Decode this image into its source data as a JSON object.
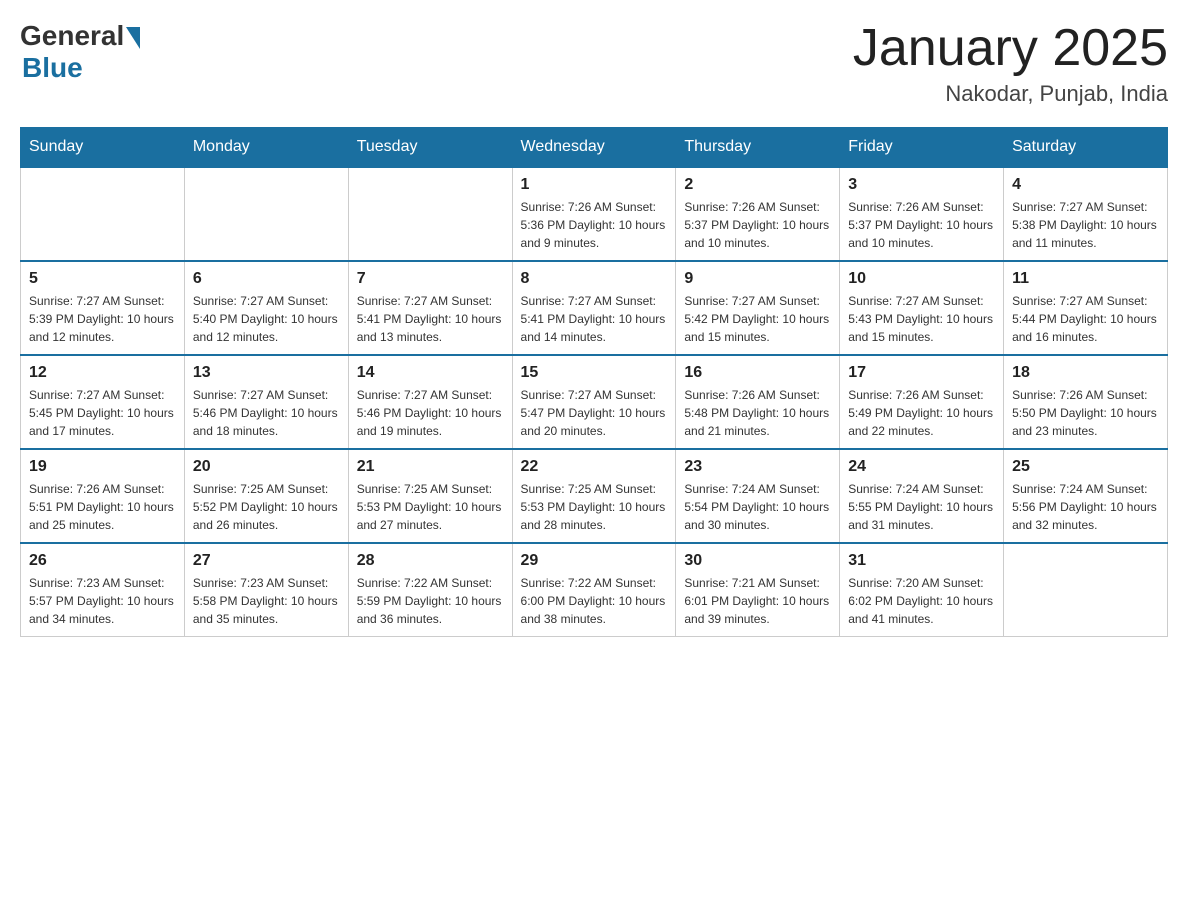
{
  "header": {
    "logo_general": "General",
    "logo_blue": "Blue",
    "month_year": "January 2025",
    "location": "Nakodar, Punjab, India"
  },
  "days_of_week": [
    "Sunday",
    "Monday",
    "Tuesday",
    "Wednesday",
    "Thursday",
    "Friday",
    "Saturday"
  ],
  "weeks": [
    [
      {
        "day": "",
        "info": ""
      },
      {
        "day": "",
        "info": ""
      },
      {
        "day": "",
        "info": ""
      },
      {
        "day": "1",
        "info": "Sunrise: 7:26 AM\nSunset: 5:36 PM\nDaylight: 10 hours and 9 minutes."
      },
      {
        "day": "2",
        "info": "Sunrise: 7:26 AM\nSunset: 5:37 PM\nDaylight: 10 hours and 10 minutes."
      },
      {
        "day": "3",
        "info": "Sunrise: 7:26 AM\nSunset: 5:37 PM\nDaylight: 10 hours and 10 minutes."
      },
      {
        "day": "4",
        "info": "Sunrise: 7:27 AM\nSunset: 5:38 PM\nDaylight: 10 hours and 11 minutes."
      }
    ],
    [
      {
        "day": "5",
        "info": "Sunrise: 7:27 AM\nSunset: 5:39 PM\nDaylight: 10 hours and 12 minutes."
      },
      {
        "day": "6",
        "info": "Sunrise: 7:27 AM\nSunset: 5:40 PM\nDaylight: 10 hours and 12 minutes."
      },
      {
        "day": "7",
        "info": "Sunrise: 7:27 AM\nSunset: 5:41 PM\nDaylight: 10 hours and 13 minutes."
      },
      {
        "day": "8",
        "info": "Sunrise: 7:27 AM\nSunset: 5:41 PM\nDaylight: 10 hours and 14 minutes."
      },
      {
        "day": "9",
        "info": "Sunrise: 7:27 AM\nSunset: 5:42 PM\nDaylight: 10 hours and 15 minutes."
      },
      {
        "day": "10",
        "info": "Sunrise: 7:27 AM\nSunset: 5:43 PM\nDaylight: 10 hours and 15 minutes."
      },
      {
        "day": "11",
        "info": "Sunrise: 7:27 AM\nSunset: 5:44 PM\nDaylight: 10 hours and 16 minutes."
      }
    ],
    [
      {
        "day": "12",
        "info": "Sunrise: 7:27 AM\nSunset: 5:45 PM\nDaylight: 10 hours and 17 minutes."
      },
      {
        "day": "13",
        "info": "Sunrise: 7:27 AM\nSunset: 5:46 PM\nDaylight: 10 hours and 18 minutes."
      },
      {
        "day": "14",
        "info": "Sunrise: 7:27 AM\nSunset: 5:46 PM\nDaylight: 10 hours and 19 minutes."
      },
      {
        "day": "15",
        "info": "Sunrise: 7:27 AM\nSunset: 5:47 PM\nDaylight: 10 hours and 20 minutes."
      },
      {
        "day": "16",
        "info": "Sunrise: 7:26 AM\nSunset: 5:48 PM\nDaylight: 10 hours and 21 minutes."
      },
      {
        "day": "17",
        "info": "Sunrise: 7:26 AM\nSunset: 5:49 PM\nDaylight: 10 hours and 22 minutes."
      },
      {
        "day": "18",
        "info": "Sunrise: 7:26 AM\nSunset: 5:50 PM\nDaylight: 10 hours and 23 minutes."
      }
    ],
    [
      {
        "day": "19",
        "info": "Sunrise: 7:26 AM\nSunset: 5:51 PM\nDaylight: 10 hours and 25 minutes."
      },
      {
        "day": "20",
        "info": "Sunrise: 7:25 AM\nSunset: 5:52 PM\nDaylight: 10 hours and 26 minutes."
      },
      {
        "day": "21",
        "info": "Sunrise: 7:25 AM\nSunset: 5:53 PM\nDaylight: 10 hours and 27 minutes."
      },
      {
        "day": "22",
        "info": "Sunrise: 7:25 AM\nSunset: 5:53 PM\nDaylight: 10 hours and 28 minutes."
      },
      {
        "day": "23",
        "info": "Sunrise: 7:24 AM\nSunset: 5:54 PM\nDaylight: 10 hours and 30 minutes."
      },
      {
        "day": "24",
        "info": "Sunrise: 7:24 AM\nSunset: 5:55 PM\nDaylight: 10 hours and 31 minutes."
      },
      {
        "day": "25",
        "info": "Sunrise: 7:24 AM\nSunset: 5:56 PM\nDaylight: 10 hours and 32 minutes."
      }
    ],
    [
      {
        "day": "26",
        "info": "Sunrise: 7:23 AM\nSunset: 5:57 PM\nDaylight: 10 hours and 34 minutes."
      },
      {
        "day": "27",
        "info": "Sunrise: 7:23 AM\nSunset: 5:58 PM\nDaylight: 10 hours and 35 minutes."
      },
      {
        "day": "28",
        "info": "Sunrise: 7:22 AM\nSunset: 5:59 PM\nDaylight: 10 hours and 36 minutes."
      },
      {
        "day": "29",
        "info": "Sunrise: 7:22 AM\nSunset: 6:00 PM\nDaylight: 10 hours and 38 minutes."
      },
      {
        "day": "30",
        "info": "Sunrise: 7:21 AM\nSunset: 6:01 PM\nDaylight: 10 hours and 39 minutes."
      },
      {
        "day": "31",
        "info": "Sunrise: 7:20 AM\nSunset: 6:02 PM\nDaylight: 10 hours and 41 minutes."
      },
      {
        "day": "",
        "info": ""
      }
    ]
  ]
}
